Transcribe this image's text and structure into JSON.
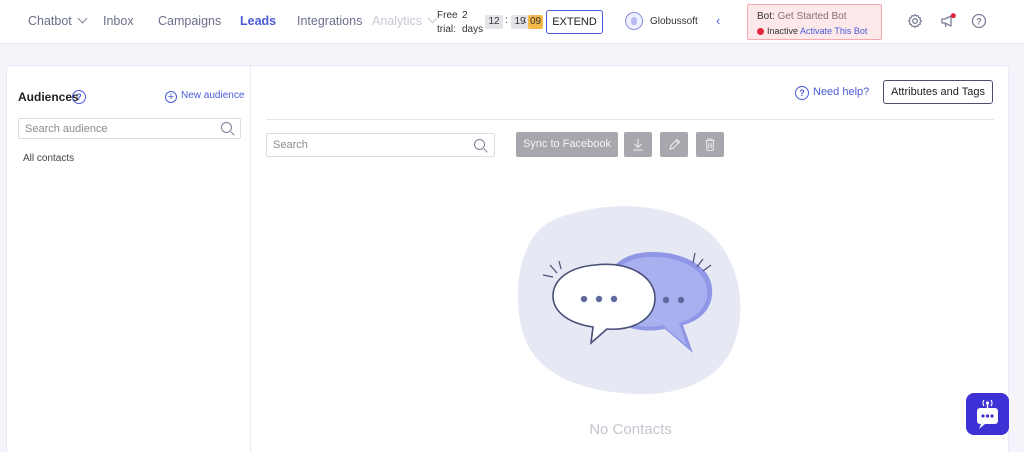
{
  "nav": {
    "items": [
      "Chatbot",
      "Inbox",
      "Campaigns",
      "Leads",
      "Integrations",
      "Analytics"
    ],
    "active": "Leads"
  },
  "trial": {
    "label_free": "Free",
    "label_trial": "trial:",
    "days_num": "2",
    "days_label": "days",
    "hours": "12",
    "minutes": "19",
    "seconds": "09",
    "extend_label": "EXTEND"
  },
  "account": {
    "name": "Globussoft"
  },
  "bot": {
    "label": "Bot:",
    "name": "Get Started Bot",
    "status": "Inactive",
    "activate_label": "Activate This Bot",
    "status_color": "#e2263b"
  },
  "sidebar": {
    "title": "Audiences",
    "new_audience_label": "New audience",
    "search_placeholder": "Search audience",
    "items": [
      "All contacts"
    ]
  },
  "main": {
    "need_help_label": "Need help?",
    "attributes_button_label": "Attributes and Tags",
    "search_placeholder": "Search",
    "sync_label": "Sync to Facebook",
    "empty_state": "No Contacts"
  },
  "colors": {
    "accent": "#4a5bd6",
    "widget": "#3d31d6"
  }
}
